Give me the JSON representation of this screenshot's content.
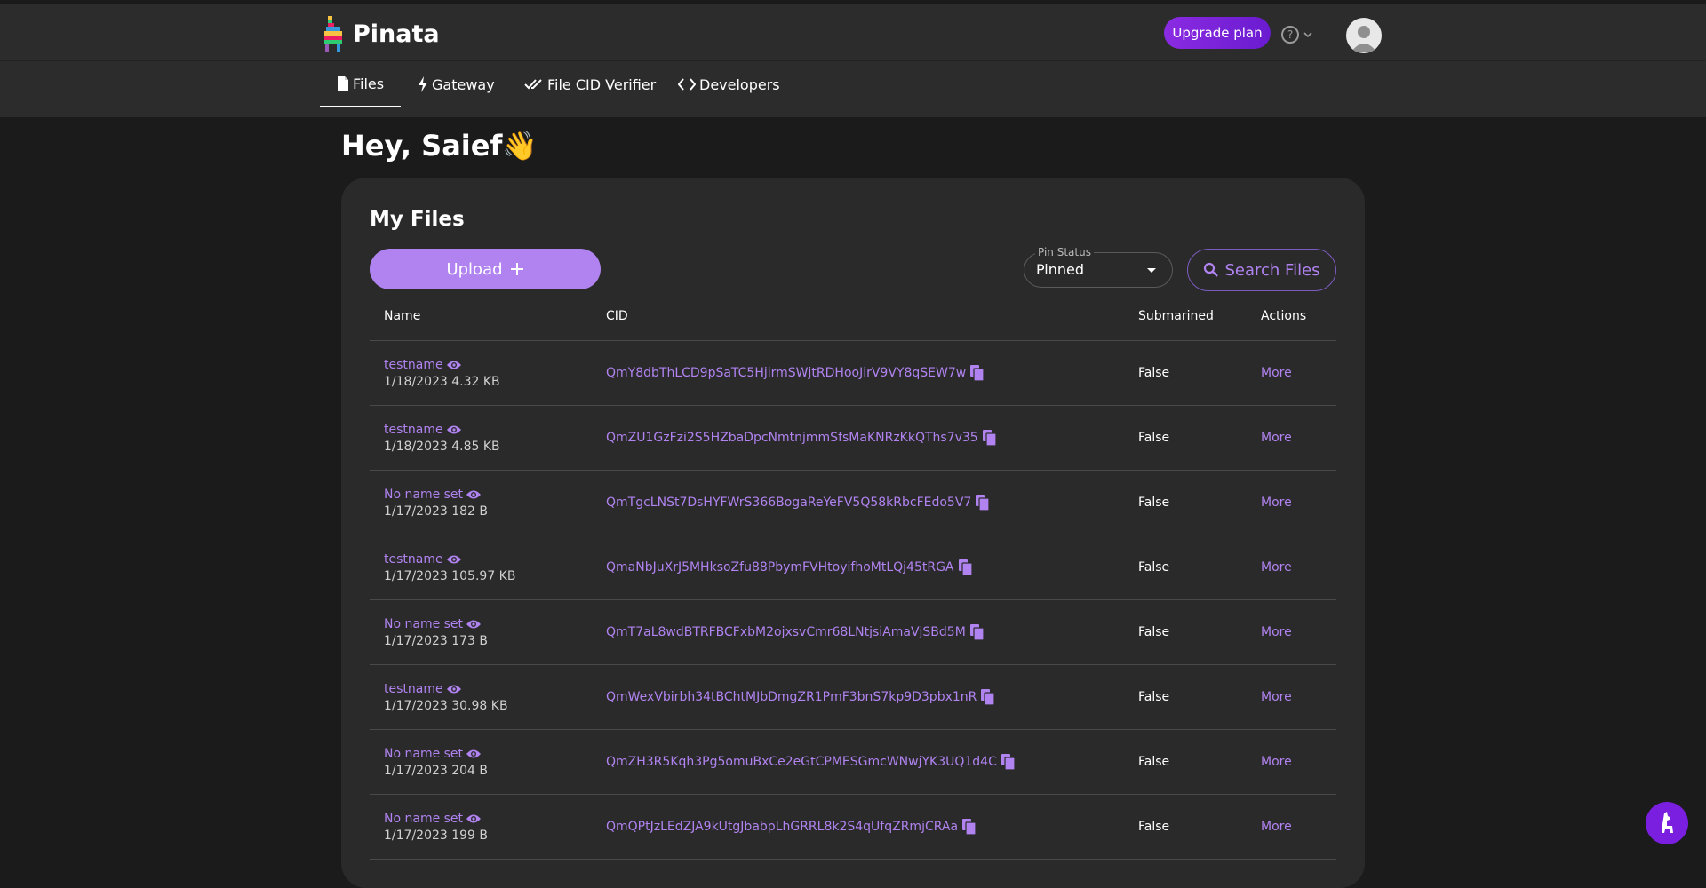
{
  "app": {
    "name": "Pinata"
  },
  "header": {
    "upgrade_label": "Upgrade plan",
    "help_icon": "help-circle-icon"
  },
  "nav": {
    "items": [
      {
        "label": "Files",
        "icon": "file-icon",
        "active": true
      },
      {
        "label": "Gateway",
        "icon": "lightning-icon",
        "active": false
      },
      {
        "label": "File CID Verifier",
        "icon": "double-check-icon",
        "active": false
      },
      {
        "label": "Developers",
        "icon": "code-icon",
        "active": false
      }
    ]
  },
  "greeting": "Hey, Saief👋",
  "files": {
    "title": "My Files",
    "upload_label": "Upload",
    "pin_status": {
      "label": "Pin Status",
      "value": "Pinned"
    },
    "search_label": "Search Files",
    "columns": {
      "name": "Name",
      "cid": "CID",
      "submarined": "Submarined",
      "actions": "Actions"
    },
    "rows": [
      {
        "name": "testname",
        "meta": "1/18/2023 4.32 KB",
        "cid": "QmY8dbThLCD9pSaTC5HjirmSWjtRDHooJirV9VY8qSEW7w",
        "submarined": "False",
        "action": "More"
      },
      {
        "name": "testname",
        "meta": "1/18/2023 4.85 KB",
        "cid": "QmZU1GzFzi2S5HZbaDpcNmtnjmmSfsMaKNRzKkQThs7v35",
        "submarined": "False",
        "action": "More"
      },
      {
        "name": "No name set",
        "meta": "1/17/2023 182 B",
        "cid": "QmTgcLNSt7DsHYFWrS366BogaReYeFV5Q58kRbcFEdo5V7",
        "submarined": "False",
        "action": "More"
      },
      {
        "name": "testname",
        "meta": "1/17/2023 105.97 KB",
        "cid": "QmaNbJuXrJ5MHksoZfu88PbymFVHtoyifhoMtLQj45tRGA",
        "submarined": "False",
        "action": "More"
      },
      {
        "name": "No name set",
        "meta": "1/17/2023 173 B",
        "cid": "QmT7aL8wdBTRFBCFxbM2ojxsvCmr68LNtjsiAmaVjSBd5M",
        "submarined": "False",
        "action": "More"
      },
      {
        "name": "testname",
        "meta": "1/17/2023 30.98 KB",
        "cid": "QmWexVbirbh34tBChtMJbDmgZR1PmF3bnS7kp9D3pbx1nR",
        "submarined": "False",
        "action": "More"
      },
      {
        "name": "No name set",
        "meta": "1/17/2023 204 B",
        "cid": "QmZH3R5Kqh3Pg5omuBxCe2eGtCPMESGmcWNwjYK3UQ1d4C",
        "submarined": "False",
        "action": "More"
      },
      {
        "name": "No name set",
        "meta": "1/17/2023 199 B",
        "cid": "QmQPtJzLEdZJA9kUtgJbabpLhGRRL8k2S4qUfqZRmjCRAa",
        "submarined": "False",
        "action": "More"
      }
    ]
  },
  "colors": {
    "accent": "#b083f0",
    "upgrade": "#8a2be2",
    "background": "#1b1b1b",
    "panel": "#2a2a2a"
  }
}
